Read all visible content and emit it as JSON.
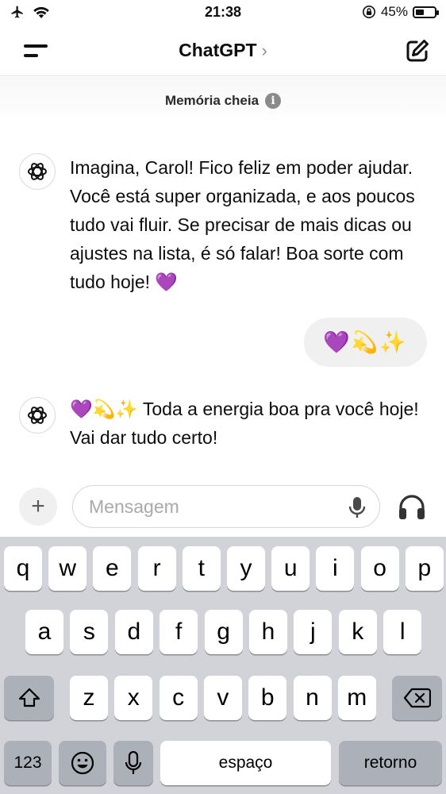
{
  "status": {
    "time": "21:38",
    "battery": "45%",
    "battery_level": 0.45
  },
  "header": {
    "title": "ChatGPT",
    "chevron": "›"
  },
  "memory_banner": {
    "text": "Memória cheia",
    "info_glyph": "i"
  },
  "messages": [
    {
      "role": "assistant",
      "text": "Imagina, Carol! Fico feliz em poder ajudar. Você está super organizada, e aos poucos tudo vai fluir. Se precisar de mais dicas ou ajustes na lista, é só falar! Boa sorte com tudo hoje! 💜"
    },
    {
      "role": "user",
      "text": "💜💫✨"
    },
    {
      "role": "assistant",
      "text": "💜💫✨ Toda a energia boa pra você hoje! Vai dar tudo certo!"
    }
  ],
  "composer": {
    "placeholder": "Mensagem",
    "plus": "+"
  },
  "keyboard": {
    "row1": [
      "q",
      "w",
      "e",
      "r",
      "t",
      "y",
      "u",
      "i",
      "o",
      "p"
    ],
    "row2": [
      "a",
      "s",
      "d",
      "f",
      "g",
      "h",
      "j",
      "k",
      "l"
    ],
    "row3": [
      "z",
      "x",
      "c",
      "v",
      "b",
      "n",
      "m"
    ],
    "numbers_label": "123",
    "space_label": "espaço",
    "return_label": "retorno"
  },
  "icons": [
    "airplane-icon",
    "wifi-icon",
    "orientation-lock-icon",
    "battery-icon",
    "menu-icon",
    "edit-icon",
    "info-icon",
    "openai-logo-icon",
    "plus-icon",
    "microphone-icon",
    "headphones-icon",
    "shift-icon",
    "backspace-icon",
    "emoji-icon"
  ]
}
